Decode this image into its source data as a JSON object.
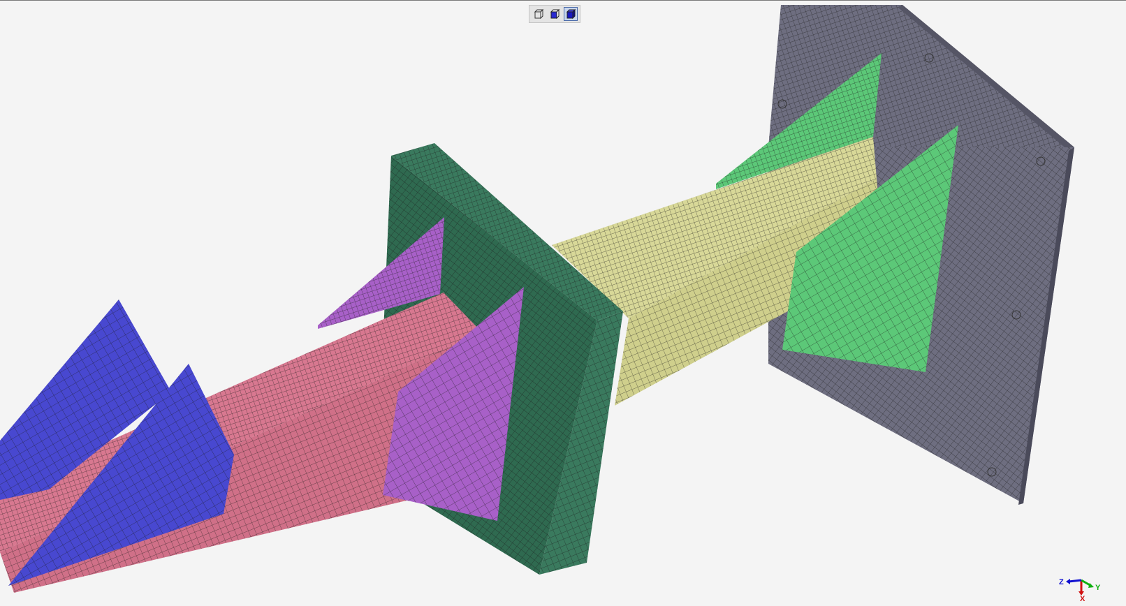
{
  "toolbar": {
    "buttons": [
      {
        "name": "wireframe-view",
        "icon": "wireframe-cube-icon",
        "active": false
      },
      {
        "name": "hidden-line-view",
        "icon": "hidden-line-cube-icon",
        "active": false
      },
      {
        "name": "shaded-view",
        "icon": "shaded-cube-icon",
        "active": true
      }
    ]
  },
  "axes": {
    "x_label": "X",
    "y_label": "Y",
    "z_label": "Z",
    "x_color": "#d01010",
    "y_color": "#10b010",
    "z_color": "#1010d0"
  },
  "parts": [
    {
      "name": "end-plate",
      "color": "#6e6e80"
    },
    {
      "name": "green-gusset",
      "color": "#5cc878"
    },
    {
      "name": "yellow-beam",
      "color": "#d8d898"
    },
    {
      "name": "flange-plate",
      "color": "#3a7a5e"
    },
    {
      "name": "purple-gusset",
      "color": "#a860c8"
    },
    {
      "name": "pink-beam",
      "color": "#d87890"
    },
    {
      "name": "blue-gusset",
      "color": "#4848d0"
    }
  ]
}
